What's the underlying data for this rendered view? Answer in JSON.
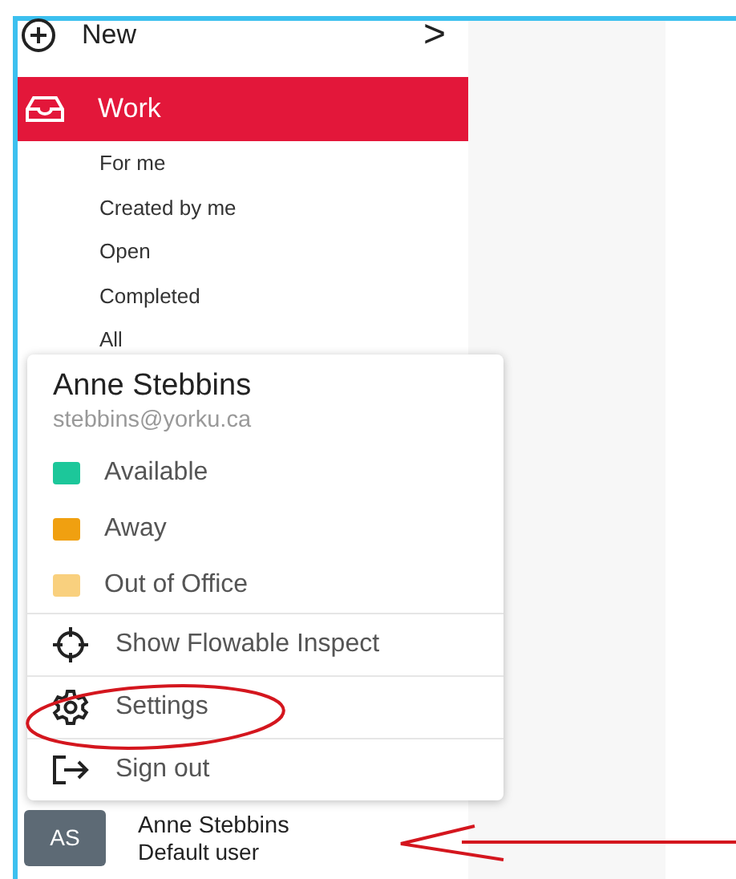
{
  "sidebar": {
    "new_item": {
      "label": "New",
      "kind": "plus",
      "arrow": ">"
    },
    "items": [
      {
        "label": "Work",
        "kind": "inbox",
        "selected": true,
        "children": [
          {
            "label": "For me"
          },
          {
            "label": "Created by me"
          },
          {
            "label": "Open"
          },
          {
            "label": "Completed"
          },
          {
            "label": "All"
          }
        ]
      }
    ]
  },
  "user_menu": {
    "name": "Anne Stebbins",
    "email": "stebbins@yorku.ca",
    "statuses": [
      {
        "label": "Available",
        "color": "#1cc79a"
      },
      {
        "label": "Away",
        "color": "#f0a010"
      },
      {
        "label": "Out of Office",
        "color": "#f9d07e"
      }
    ],
    "actions": [
      {
        "label": "Show Flowable Inspect",
        "kind": "inspect"
      },
      {
        "label": "Settings",
        "kind": "settings"
      },
      {
        "label": "Sign out",
        "kind": "signout"
      }
    ]
  },
  "current_user": {
    "initials": "AS",
    "name": "Anne Stebbins",
    "role": "Default user"
  }
}
